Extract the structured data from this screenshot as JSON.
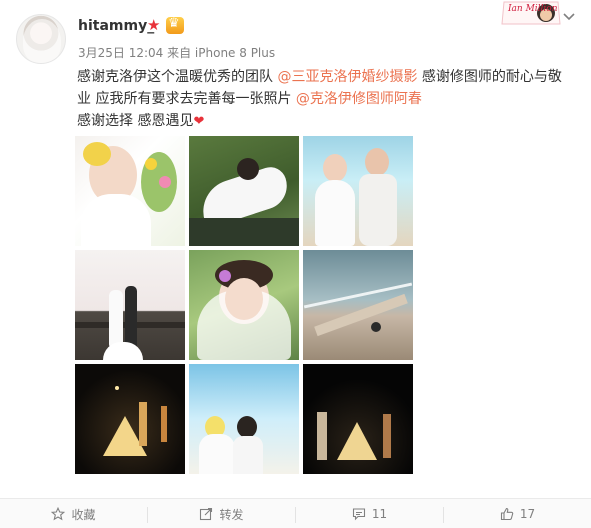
{
  "user": {
    "name": "hitammy_"
  },
  "post": {
    "meta": "3月25日 12:04 来自 iPhone 8 Plus",
    "line1_a": "感谢克洛伊这个温暖优秀的团队 ",
    "line1_mention": "@三亚克洛伊婚纱摄影",
    "line1_b": " 感谢修图师的耐心与敬",
    "line2_a": "业 应我所有要求去完善每一张照片 ",
    "line2_mention": "@克洛伊修图师阿春",
    "line3": "感谢选择 感恩遇见"
  },
  "sticker": {
    "text": "Ian Million"
  },
  "actions": {
    "favorite": "收藏",
    "repost": "转发",
    "comments": "11",
    "likes": "17"
  },
  "colors": {
    "mention": "#eb7350",
    "vip": "#e8323a"
  }
}
